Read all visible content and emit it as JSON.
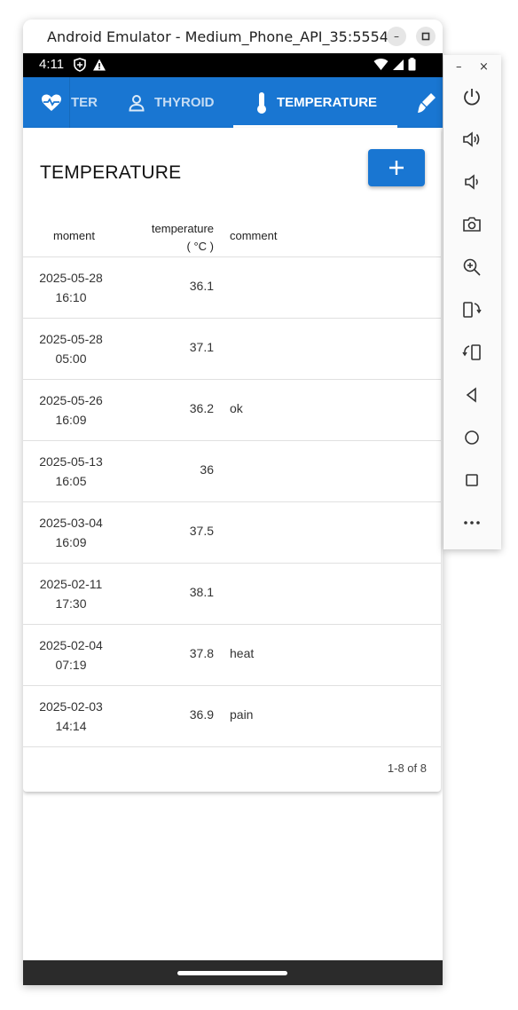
{
  "window": {
    "title": "Android Emulator - Medium_Phone_API_35:5554",
    "minimize_label": "–",
    "maximize_label": "▢"
  },
  "statusbar": {
    "time": "4:11"
  },
  "tabs": [
    {
      "label": "TER",
      "icon": "heart-pulse-icon",
      "active": false
    },
    {
      "label": "THYROID",
      "icon": "person-icon",
      "active": false
    },
    {
      "label": "TEMPERATURE",
      "icon": "thermometer-icon",
      "active": true
    },
    {
      "label": "",
      "icon": "brush-icon",
      "active": false
    }
  ],
  "page": {
    "title": "TEMPERATURE",
    "add_button": "+"
  },
  "table": {
    "columns": {
      "moment": "moment",
      "temperature": "temperature",
      "unit": "( °C )",
      "comment": "comment"
    },
    "rows": [
      {
        "date": "2025-05-28",
        "time": "16:10",
        "temperature": "36.1",
        "comment": ""
      },
      {
        "date": "2025-05-28",
        "time": "05:00",
        "temperature": "37.1",
        "comment": ""
      },
      {
        "date": "2025-05-26",
        "time": "16:09",
        "temperature": "36.2",
        "comment": "ok"
      },
      {
        "date": "2025-05-13",
        "time": "16:05",
        "temperature": "36",
        "comment": ""
      },
      {
        "date": "2025-03-04",
        "time": "16:09",
        "temperature": "37.5",
        "comment": ""
      },
      {
        "date": "2025-02-11",
        "time": "17:30",
        "temperature": "38.1",
        "comment": ""
      },
      {
        "date": "2025-02-04",
        "time": "07:19",
        "temperature": "37.8",
        "comment": "heat"
      },
      {
        "date": "2025-02-03",
        "time": "14:14",
        "temperature": "36.9",
        "comment": "pain"
      }
    ],
    "pagination": "1-8 of 8"
  },
  "side_toolbar": {
    "minimize": "–",
    "close": "×",
    "buttons": [
      "power-icon",
      "volume-up-icon",
      "volume-down-icon",
      "camera-icon",
      "zoom-icon",
      "rotate-left-icon",
      "rotate-right-icon",
      "back-icon",
      "home-icon",
      "overview-icon",
      "more-icon"
    ]
  },
  "colors": {
    "primary": "#1976d2",
    "statusbar": "#000000",
    "navbar": "#2b2b2b"
  }
}
